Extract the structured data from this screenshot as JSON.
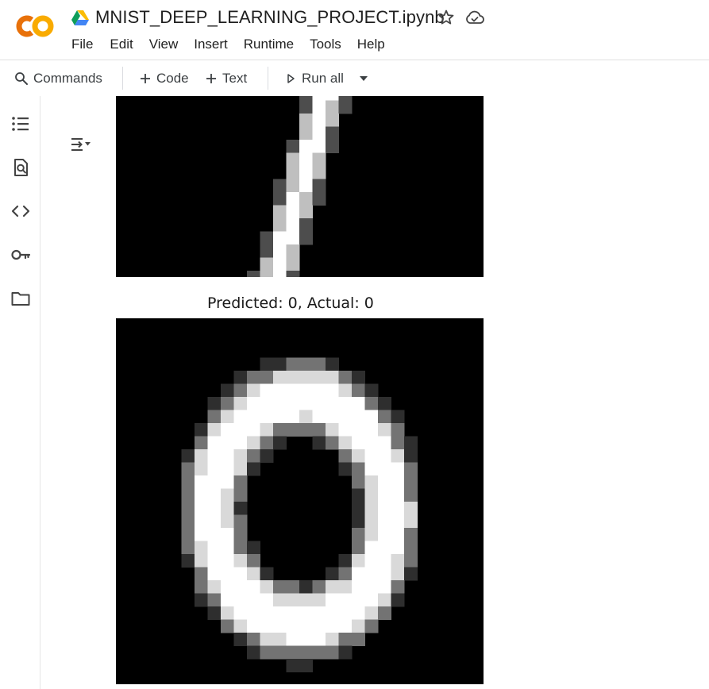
{
  "app": {
    "notebook_title": "MNIST_DEEP_LEARNING_PROJECT.ipynb",
    "logo_text": "CO",
    "icons": {
      "logo": "colab-logo-icon",
      "drive": "google-drive-icon",
      "star": "star-icon",
      "cloud": "cloud-saved-icon"
    }
  },
  "menu": [
    "File",
    "Edit",
    "View",
    "Insert",
    "Runtime",
    "Tools",
    "Help"
  ],
  "toolbar": {
    "commands_label": "Commands",
    "add_code_label": "Code",
    "add_text_label": "Text",
    "run_all_label": "Run all"
  },
  "sidebar": {
    "items": [
      {
        "icon": "table-of-contents-icon"
      },
      {
        "icon": "find-replace-icon"
      },
      {
        "icon": "code-snippets-icon"
      },
      {
        "icon": "secrets-key-icon"
      },
      {
        "icon": "files-folder-icon"
      }
    ]
  },
  "output": {
    "toggle_icon": "output-toggle-icon",
    "images": [
      {
        "caption": "",
        "digit": "1"
      },
      {
        "caption": "Predicted: 0, Actual: 0",
        "digit": "0"
      }
    ]
  },
  "colors": {
    "logo_orange": "#F9AB00",
    "logo_dark_orange": "#E8710A",
    "text_primary": "#1f1f1f",
    "toolbar_text": "#3c4043",
    "divider": "#dadce0",
    "digit_background": "#000000"
  }
}
